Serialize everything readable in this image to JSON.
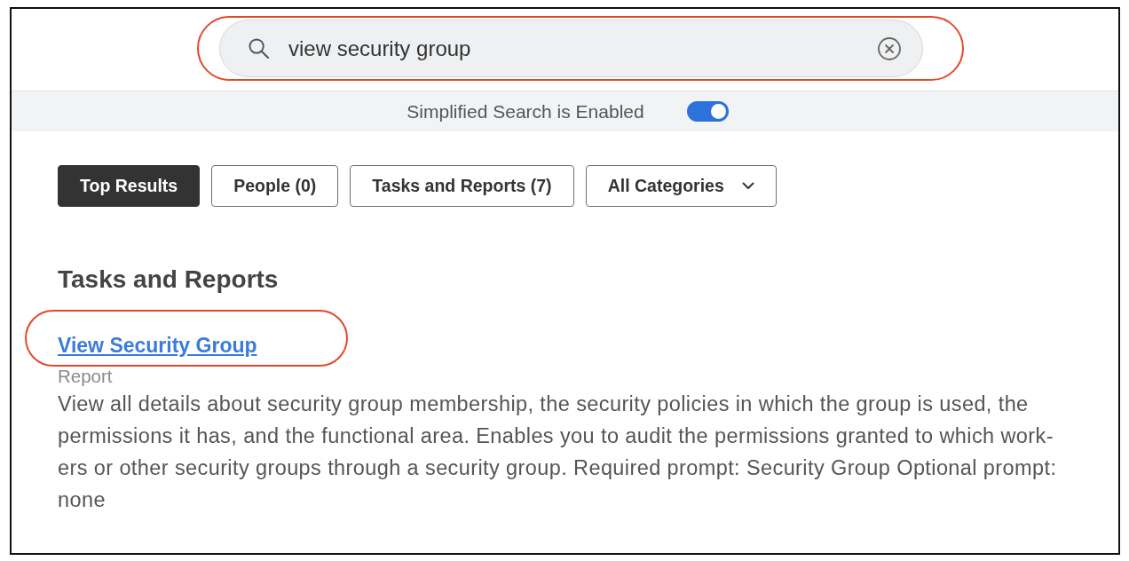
{
  "search": {
    "value": "view security group",
    "highlighted": true
  },
  "banner": {
    "label": "Simplified Search is Enabled",
    "enabled": true
  },
  "filters": [
    {
      "label": "Top Results",
      "selected": true,
      "kind": "tab"
    },
    {
      "label": "People (0)",
      "selected": false,
      "kind": "tab"
    },
    {
      "label": "Tasks and Reports (7)",
      "selected": false,
      "kind": "tab"
    },
    {
      "label": "All Categories",
      "selected": false,
      "kind": "dropdown"
    }
  ],
  "section": {
    "title": "Tasks and Reports",
    "results": [
      {
        "title": "View Security Group",
        "type": "Report",
        "description": "View all details about security group membership, the security policies in which the group is used, the permissions it has, and the functional area. Enables you to audit the permissions granted to which work-ers or other security groups through a security group. Required prompt: Security Group Optional prompt: none",
        "highlighted": true
      }
    ]
  }
}
